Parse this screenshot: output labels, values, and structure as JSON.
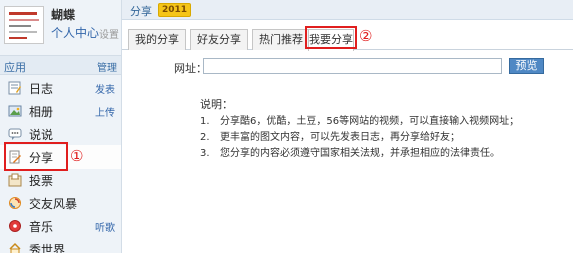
{
  "profile": {
    "name": "蝴蝶",
    "center_link": "个人中心",
    "settings_link": "设置"
  },
  "apps_section": {
    "title": "应用",
    "manage_link": "管理"
  },
  "menu": [
    {
      "label": "日志",
      "icon": "blog-icon",
      "action": "发表"
    },
    {
      "label": "相册",
      "icon": "photo-album-icon",
      "action": "上传"
    },
    {
      "label": "说说",
      "icon": "speech-bubble-icon",
      "action": ""
    },
    {
      "label": "分享",
      "icon": "share-icon",
      "action": ""
    },
    {
      "label": "投票",
      "icon": "vote-icon",
      "action": ""
    },
    {
      "label": "交友风暴",
      "icon": "friends-storm-icon",
      "action": ""
    },
    {
      "label": "音乐",
      "icon": "music-icon",
      "action": "听歌"
    },
    {
      "label": "秀世界",
      "icon": "show-world-icon",
      "action": ""
    }
  ],
  "annotations": {
    "marker1": "①",
    "marker2": "②",
    "color": "#e01e1e"
  },
  "header": {
    "title": "分享",
    "badge": "2011"
  },
  "tabs": [
    {
      "label": "我的分享"
    },
    {
      "label": "好友分享"
    },
    {
      "label": "热门推荐"
    },
    {
      "label": "我要分享"
    }
  ],
  "form": {
    "url_label": "网址：",
    "url_value": "",
    "preview_button": "预览"
  },
  "notes": {
    "title": "说明：",
    "items": [
      {
        "num": "1.",
        "text": "分享酷6，优酷，土豆，56等网站的视频，可以直接输入视频网址；"
      },
      {
        "num": "2.",
        "text": "更丰富的图文内容，可以先发表日志，再分享给好友；"
      },
      {
        "num": "3.",
        "text": "您分享的内容必须遵守国家相关法规，并承担相应的法律责任。"
      }
    ]
  },
  "colors": {
    "sidebar_bg": "#eef3f8",
    "link_blue": "#3366aa",
    "preview_button_bg": "#4f88c4",
    "badge_bg": "#f5c518"
  }
}
